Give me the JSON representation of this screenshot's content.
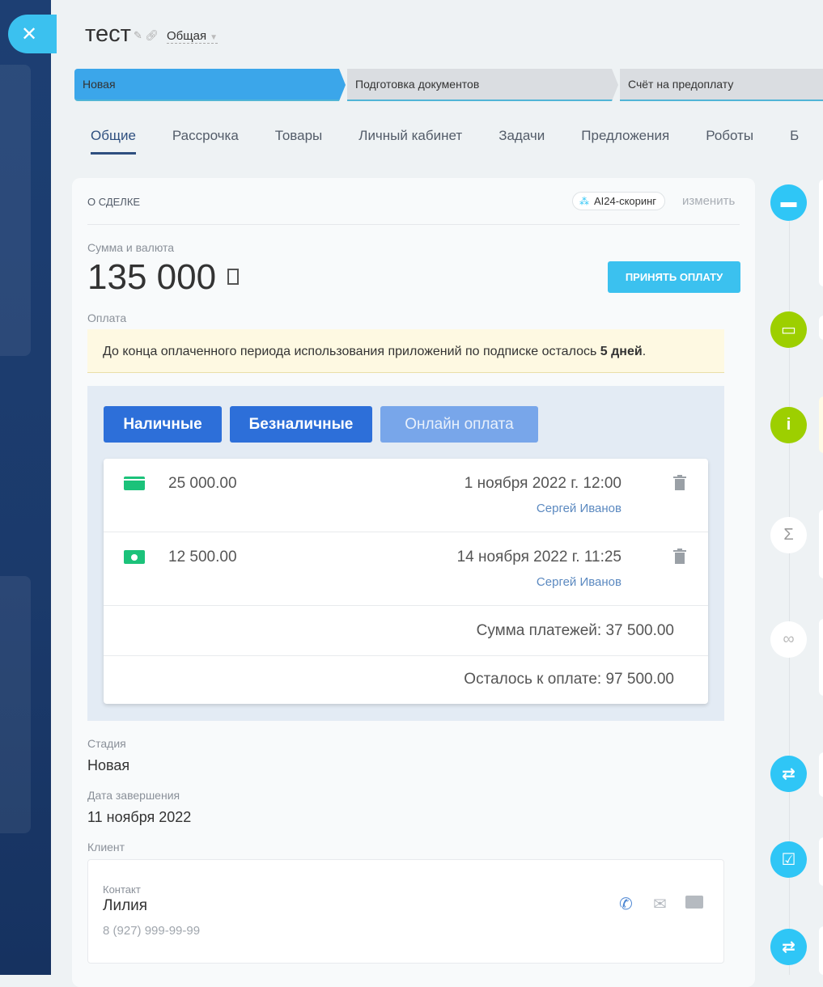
{
  "header": {
    "title": "тест",
    "category": "Общая"
  },
  "stages": [
    "Новая",
    "Подготовка документов",
    "Счёт на предоплату"
  ],
  "tabs": [
    "Общие",
    "Рассрочка",
    "Товары",
    "Личный кабинет",
    "Задачи",
    "Предложения",
    "Роботы",
    "Б"
  ],
  "deal": {
    "section_title": "О СДЕЛКЕ",
    "ai_badge": "AI24-скоринг",
    "change_link": "изменить",
    "amount_label": "Сумма и валюта",
    "amount": "135 000",
    "accept_button": "ПРИНЯТЬ ОПЛАТУ",
    "payment_label": "Оплата",
    "notice_text": "До конца оплаченного периода использования приложений по подписке осталось ",
    "notice_bold": "5 дней",
    "payment_tabs": [
      "Наличные",
      "Безналичные",
      "Онлайн оплата"
    ],
    "payments": [
      {
        "icon": "card-icon",
        "sum": "25 000.00",
        "date": "1 ноября 2022 г. 12:00",
        "user": "Сергей Иванов"
      },
      {
        "icon": "cash-icon",
        "sum": "12 500.00",
        "date": "14 ноября 2022 г. 11:25",
        "user": "Сергей Иванов"
      }
    ],
    "total_paid": "Сумма платежей: 37 500.00",
    "remaining": "Осталось к оплате: 97 500.00",
    "stage_label": "Стадия",
    "stage_value": "Новая",
    "close_date_label": "Дата завершения",
    "close_date_value": "11 ноября 2022",
    "client_label": "Клиент",
    "contact_label": "Контакт",
    "contact_name": "Лилия",
    "contact_phone": "8 (927) 999-99-99"
  },
  "colors": {
    "accent": "#3bc1ef",
    "stage_active": "#3ba6ea",
    "payment_button": "#2d6fd9",
    "timeline_green": "#9dcf00"
  }
}
